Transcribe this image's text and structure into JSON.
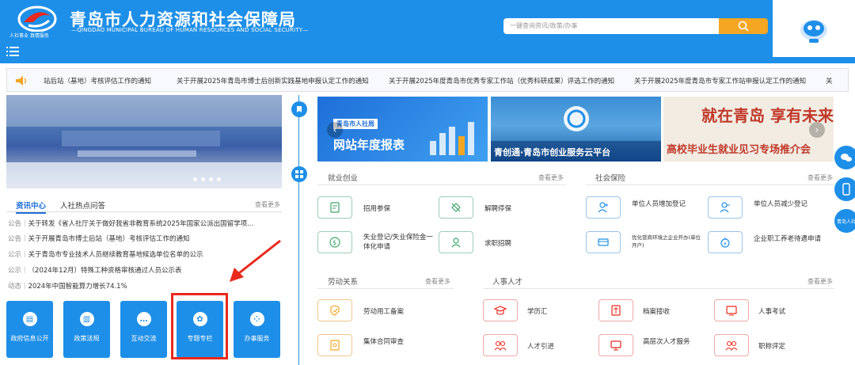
{
  "header": {
    "title": "青岛市人力资源和社会保障局",
    "subtitle_en": "QINGDAO MUNICIPAL BUREAU OF HUMAN RESOURCES AND SOCIAL SECURITY",
    "logo_caption": "人社事业 真情服务",
    "search_placeholder": "一键查询资讯/政策/办事"
  },
  "ticker": {
    "items": [
      "站后站（基地）考核评估工作的通知",
      "关于开展2025年青岛市博士后创新实践基地申报认定工作的通知",
      "关于开展2025年度青岛市优秀专家工作站（优秀科研成果）评选工作的通知",
      "关于开展2025年度青岛市专家工作站申报认定工作的通知",
      "关"
    ]
  },
  "news_tabs": {
    "active": "资讯中心",
    "other": "人社热点问答",
    "more": "查看更多"
  },
  "news": [
    {
      "tag": "公告",
      "text": "关于转发《省人社厅关于做好我省非教育系统2025年国家公派出国留学项..."
    },
    {
      "tag": "公告",
      "text": "关于开展青岛市博士后站（基地）考核评估工作的通知"
    },
    {
      "tag": "公示",
      "text": "关于青岛市专业技术人员继续教育基地候选单位名单的公示"
    },
    {
      "tag": "公示",
      "text": "（2024年12月）特殊工种资格审核通过人员公示表"
    },
    {
      "tag": "动态",
      "text": "2024年中国智能算力增长74.1%"
    }
  ],
  "quick_buttons": [
    {
      "label": "政府信息公开",
      "icon": "document-icon"
    },
    {
      "label": "政策法规",
      "icon": "book-icon"
    },
    {
      "label": "互动交流",
      "icon": "chat-icon"
    },
    {
      "label": "专题专栏",
      "icon": "gear-icon"
    },
    {
      "label": "办事服务",
      "icon": "grid-icon"
    }
  ],
  "promos": [
    {
      "tag": "青岛市人社局",
      "title": "网站年度报表"
    },
    {
      "title": "青创通·青岛市创业服务云平台"
    },
    {
      "title": "高校毕业生就业见习专场推介会",
      "big": "就在青岛 享有未来"
    }
  ],
  "sections": {
    "employment": {
      "title": "就业创业",
      "more": "查看更多",
      "items": [
        "招用参保",
        "解聘停保",
        "失业登记/失业保险金一体化申请",
        "求职招聘"
      ]
    },
    "insurance": {
      "title": "社会保险",
      "more": "查看更多",
      "items": [
        "单位人员增加登记",
        "单位人员减少登记",
        "优化营商环境之企业开办(单位开户)",
        "企业职工养老待遇申请"
      ]
    },
    "labor": {
      "title": "劳动关系",
      "more": "查看更多",
      "items": [
        "劳动用工备案",
        "集体合同审查"
      ]
    },
    "talent": {
      "title": "人事人才",
      "more": "查看更多",
      "items": [
        "学历汇",
        "档案接收",
        "人事考试",
        "人才引进",
        "高层次人才服务",
        "职称评定"
      ]
    }
  },
  "side_buttons": [
    "微信",
    "移动端",
    "青岛人社"
  ],
  "colors": {
    "primary": "#1e8fe8",
    "accent": "#f5a623",
    "highlight": "#e8291c"
  }
}
